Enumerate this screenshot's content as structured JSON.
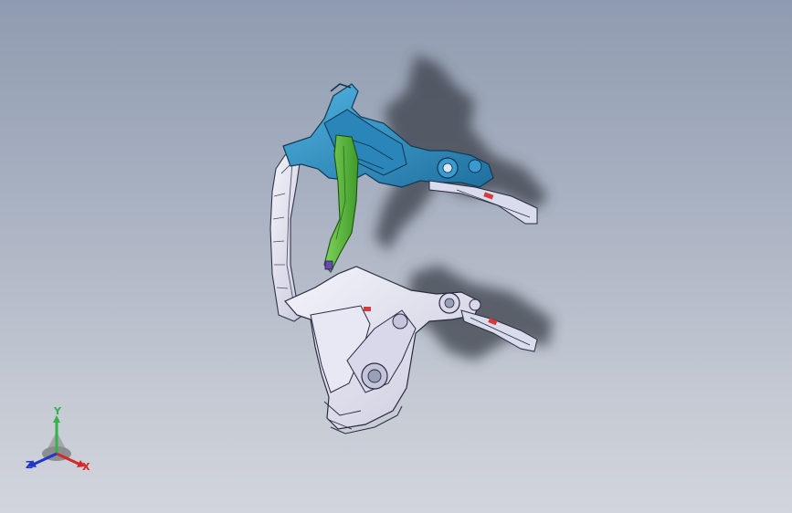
{
  "viewport": {
    "background_top": "#8f9bb0",
    "background_bottom": "#d2d5dc"
  },
  "model": {
    "colors": {
      "upper_assembly": "#2f8fc4",
      "upper_assembly_dark": "#1b5f8c",
      "pillar": "#57b43a",
      "lower_assembly": "#e6e6f4",
      "lower_assembly_edge": "#3a3a4a",
      "shadow": "#3a3f48",
      "accent_red": "#d63a3a"
    }
  },
  "triad": {
    "y_label": "Y",
    "x_label": "X",
    "z_label": "Z",
    "y_color": "#35b24a",
    "x_color": "#d62828",
    "z_color": "#2236c8"
  }
}
